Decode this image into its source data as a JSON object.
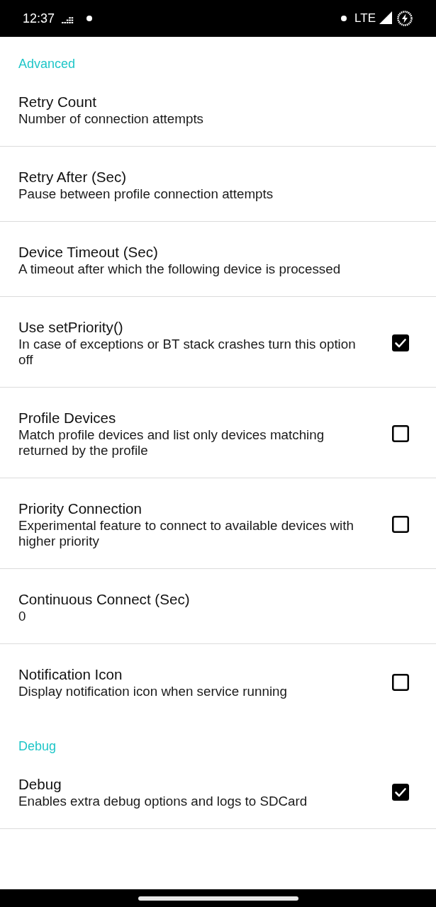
{
  "status_bar": {
    "time": "12:37",
    "network": "LTE"
  },
  "sections": [
    {
      "title": "Advanced",
      "items": [
        {
          "kind": "text",
          "title": "Retry Count",
          "summary": "Number of connection attempts"
        },
        {
          "kind": "text",
          "title": "Retry After (Sec)",
          "summary": "Pause between profile connection attempts"
        },
        {
          "kind": "text",
          "title": "Device Timeout (Sec)",
          "summary": "A timeout after which the following device is processed"
        },
        {
          "kind": "checkbox",
          "title": "Use setPriority()",
          "summary": "In case of exceptions or BT stack crashes turn this option off",
          "checked": true
        },
        {
          "kind": "checkbox",
          "title": "Profile Devices",
          "summary": "Match profile devices and list only devices matching returned by the profile",
          "checked": false
        },
        {
          "kind": "checkbox",
          "title": "Priority Connection",
          "summary": "Experimental feature to connect to available devices with higher priority",
          "checked": false
        },
        {
          "kind": "text",
          "title": "Continuous Connect (Sec)",
          "summary": "0"
        },
        {
          "kind": "checkbox",
          "title": "Notification Icon",
          "summary": "Display notification icon when service running",
          "checked": false
        }
      ]
    },
    {
      "title": "Debug",
      "items": [
        {
          "kind": "checkbox",
          "title": "Debug",
          "summary": "Enables extra debug options and logs to SDCard",
          "checked": true
        }
      ]
    }
  ]
}
